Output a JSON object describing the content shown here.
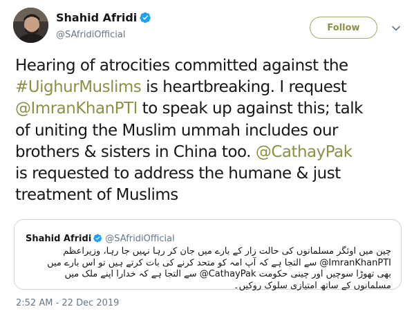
{
  "author": {
    "name": "Shahid Afridi",
    "handle": "@SAfridiOfficial",
    "verified_color": "#1da1f2"
  },
  "follow_button": {
    "label": "Follow"
  },
  "more_menu": {
    "icon": "chevron-down-icon"
  },
  "tweet": {
    "line1_a": "Hearing of atrocities committed against the",
    "hashtag": "#UighurMuslims",
    "line2_b": " is heartbreaking. I request",
    "mention1": "@ImranKhanPTI",
    "line3_b": " to speak up against this; talk",
    "line4": "of uniting the Muslim ummah includes our",
    "line5_a": "brothers & sisters in China too. ",
    "mention2": "@CathayPak",
    "line6": " is requested to address the humane & just",
    "line7": "treatment of Muslims",
    "link_color": "#8d8f45"
  },
  "quote": {
    "name": "Shahid Afridi",
    "handle": "@SAfridiOfficial",
    "body": "چین میں اوئگر مسلمانوں کی حالت زار کے بارے میں جان کر رہا نہیں جا رہا، وزیراعظم ImranKhanPTI@ سے التجا ہے کہ آپ امہ کو متحد کرنے کی بات کرتے ہیں تو اس بارے میں بھی تھوڑا سوچیں اور چینی حکومت CathayPak@ سے التجا ہے کہ خدارا اپنے ملک میں مسلمانوں کے ساتھ امتیازی سلوک روکیں۔"
  },
  "timestamp": "2:52 AM - 22 Dec 2019"
}
